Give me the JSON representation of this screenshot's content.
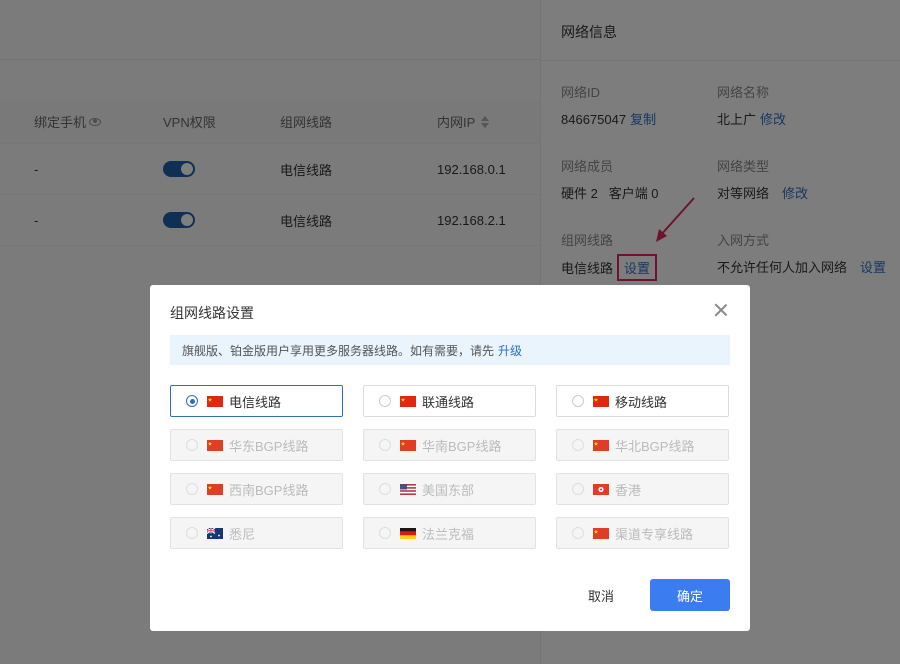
{
  "table": {
    "headers": [
      "绑定手机",
      "VPN权限",
      "组网线路",
      "内网IP"
    ],
    "rows": [
      {
        "phone": "-",
        "line": "电信线路",
        "ip": "192.168.0.1"
      },
      {
        "phone": "-",
        "line": "电信线路",
        "ip": "192.168.2.1"
      }
    ]
  },
  "drawer": {
    "title": "网络信息",
    "network_id_label": "网络ID",
    "network_id": "846675047",
    "copy": "复制",
    "network_name_label": "网络名称",
    "network_name": "北上广",
    "edit": "修改",
    "members_label": "网络成员",
    "hardware": "硬件 2",
    "clients": "客户端 0",
    "type_label": "网络类型",
    "type_value": "对等网络",
    "line_label": "组网线路",
    "line_value": "电信线路",
    "set": "设置",
    "join_label": "入网方式",
    "join_value": "不允许任何人加入网络"
  },
  "modal": {
    "title": "组网线路设置",
    "notice": "旗舰版、铂金版用户享用更多服务器线路。如有需要，请先",
    "upgrade": "升级",
    "options": [
      {
        "label": "电信线路",
        "flag": "cn"
      },
      {
        "label": "联通线路",
        "flag": "cn"
      },
      {
        "label": "移动线路",
        "flag": "cn"
      },
      {
        "label": "华东BGP线路",
        "flag": "cn"
      },
      {
        "label": "华南BGP线路",
        "flag": "cn"
      },
      {
        "label": "华北BGP线路",
        "flag": "cn"
      },
      {
        "label": "西南BGP线路",
        "flag": "cn"
      },
      {
        "label": "美国东部",
        "flag": "us"
      },
      {
        "label": "香港",
        "flag": "hk"
      },
      {
        "label": "悉尼",
        "flag": "au"
      },
      {
        "label": "法兰克福",
        "flag": "de"
      },
      {
        "label": "渠道专享线路",
        "flag": "cn"
      }
    ],
    "selected": "电信线路",
    "cancel": "取消",
    "confirm": "确定"
  },
  "colors": {
    "accent": "#3b7cf0",
    "link": "#2d6ec5",
    "highlight": "#e0245e"
  }
}
